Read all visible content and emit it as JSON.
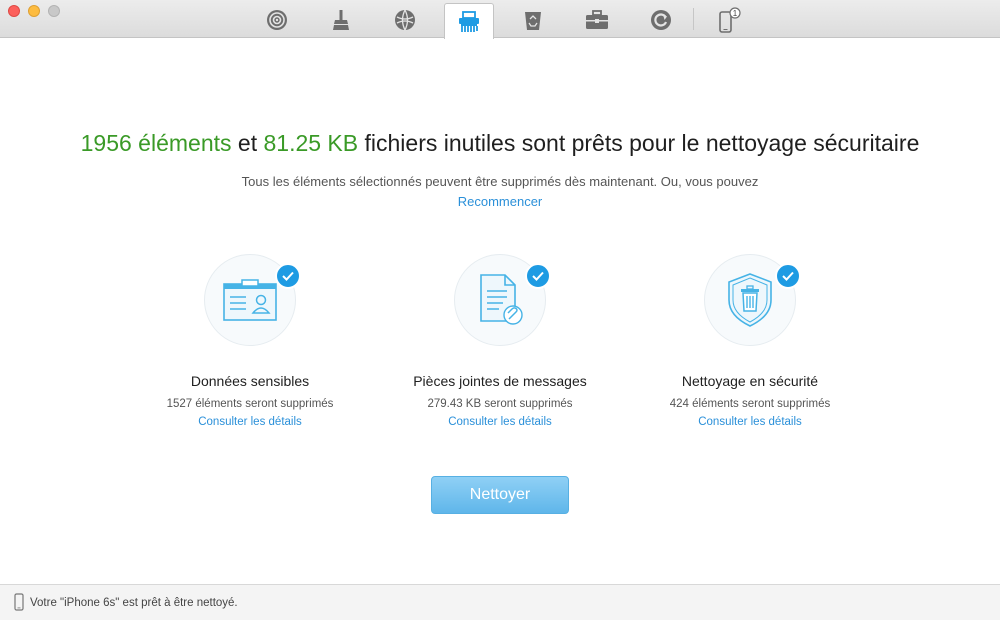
{
  "toolbar": {
    "items": [
      {
        "name": "airbackup-icon"
      },
      {
        "name": "cleaner-broom-icon"
      },
      {
        "name": "internet-globe-icon"
      },
      {
        "name": "shredder-icon"
      },
      {
        "name": "recycle-bin-icon"
      },
      {
        "name": "toolbox-icon"
      },
      {
        "name": "refresh-icon"
      },
      {
        "name": "iphone-icon"
      }
    ],
    "device_badge": "1"
  },
  "headline": {
    "count": "1956 éléments",
    "conj": " et ",
    "size": "81.25 KB",
    "rest": " fichiers inutiles sont prêts pour le nettoyage sécuritaire"
  },
  "subtitle": "Tous les éléments sélectionnés peuvent être supprimés dès maintenant. Ou, vous pouvez",
  "restart_link": "Recommencer",
  "cards": [
    {
      "title": "Données sensibles",
      "desc": "1527 éléments seront supprimés",
      "link": "Consulter les détails"
    },
    {
      "title": "Pièces jointes de messages",
      "desc": "279.43 KB seront supprimés",
      "link": "Consulter les détails"
    },
    {
      "title": "Nettoyage en sécurité",
      "desc": "424 éléments seront supprimés",
      "link": "Consulter les détails"
    }
  ],
  "clean_button": "Nettoyer",
  "status": "Votre \"iPhone 6s\" est prêt à être nettoyé.",
  "colors": {
    "accent_green": "#3a9a27",
    "link_blue": "#2b90d9",
    "check_blue": "#1e9be3",
    "icon_blue": "#46b3e6"
  }
}
